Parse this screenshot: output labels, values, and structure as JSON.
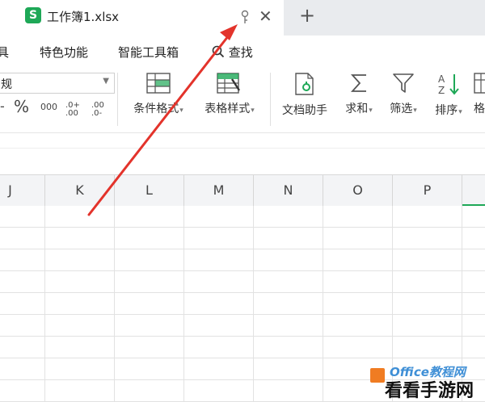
{
  "tab": {
    "title": "工作簿1.xlsx",
    "logo_letter": "S",
    "close_glyph": "✕",
    "new_tab_glyph": "+"
  },
  "menu": [
    {
      "label": "具"
    },
    {
      "label": "特色功能"
    },
    {
      "label": "智能工具箱"
    },
    {
      "label": "查找"
    }
  ],
  "ribbon": {
    "number_format_value": "规",
    "number_buttons": [
      "-",
      "%",
      "000",
      ".0+ .00",
      ".00 .0-"
    ],
    "buttons": [
      {
        "label": "条件格式",
        "dropdown": true
      },
      {
        "label": "表格样式",
        "dropdown": true
      },
      {
        "label": "文档助手",
        "dropdown": false
      },
      {
        "label": "求和",
        "dropdown": true
      },
      {
        "label": "筛选",
        "dropdown": true
      },
      {
        "label": "排序",
        "dropdown": true
      },
      {
        "label": "格",
        "dropdown": false
      }
    ]
  },
  "columns": [
    "J",
    "K",
    "L",
    "M",
    "N",
    "O",
    "P"
  ],
  "watermark": {
    "brand": "Office教程网",
    "site": "看看手游网"
  },
  "colors": {
    "accent_green": "#1ea857",
    "arrow_red": "#e3332b",
    "header_bg": "#f3f4f6"
  }
}
